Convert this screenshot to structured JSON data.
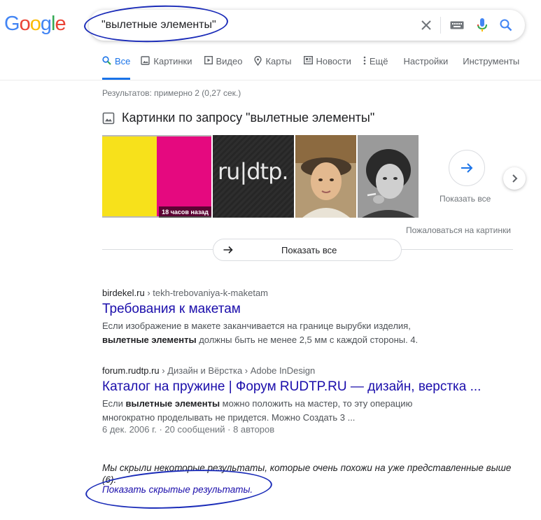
{
  "logo": [
    "G",
    "o",
    "o",
    "g",
    "l",
    "e"
  ],
  "logo_colors": [
    "#4285F4",
    "#EA4335",
    "#FBBC05",
    "#4285F4",
    "#34A853",
    "#EA4335"
  ],
  "search": {
    "value": "\"вылетные элементы\""
  },
  "tabs": [
    {
      "label": "Все",
      "icon": "search-icon",
      "active": true
    },
    {
      "label": "Картинки",
      "icon": "image-icon"
    },
    {
      "label": "Видео",
      "icon": "video-icon"
    },
    {
      "label": "Карты",
      "icon": "map-pin-icon"
    },
    {
      "label": "Новости",
      "icon": "news-icon"
    },
    {
      "label": "Ещё",
      "icon": "more-vert-icon"
    },
    {
      "label": "Настройки"
    },
    {
      "label": "Инструменты"
    }
  ],
  "stats": "Результатов: примерно 2 (0,27 сек.)",
  "images": {
    "heading": "Картинки по запросу \"вылетные элементы\"",
    "badge": "18 часов назад",
    "thumb2_text": "ru|dtp.",
    "show_all_label": "Показать все",
    "report": "Пожаловаться на картинки",
    "show_all_pill": "Показать все"
  },
  "results": [
    {
      "site": "birdekel.ru",
      "path": "› tekh-trebovaniya-k-maketam",
      "title": "Требования к макетам",
      "snippet_a": "Если изображение в макете заканчивается на границе вырубки изделия, ",
      "snippet_b": "вылетные элементы",
      "snippet_c": " должны быть не менее 2,5 мм с каждой стороны. 4."
    },
    {
      "site": "forum.rudtp.ru",
      "path": "› Дизайн и Вёрстка › Adobe InDesign",
      "title": "Каталог на пружине | Форум RUDTP.RU — дизайн, верстка ...",
      "snippet_a": "Если ",
      "snippet_b": "вылетные элементы",
      "snippet_c": " можно положить на мастер, то эту операцию многократно проделывать не придется. Можно Создать 3 ...",
      "meta": "6 дек. 2006 г. · 20 сообщений · 8 авторов"
    }
  ],
  "omitted": {
    "text": "Мы скрыли некоторые результаты, которые очень похожи на уже представленные выше (6).",
    "link": "Показать скрытые результаты."
  }
}
